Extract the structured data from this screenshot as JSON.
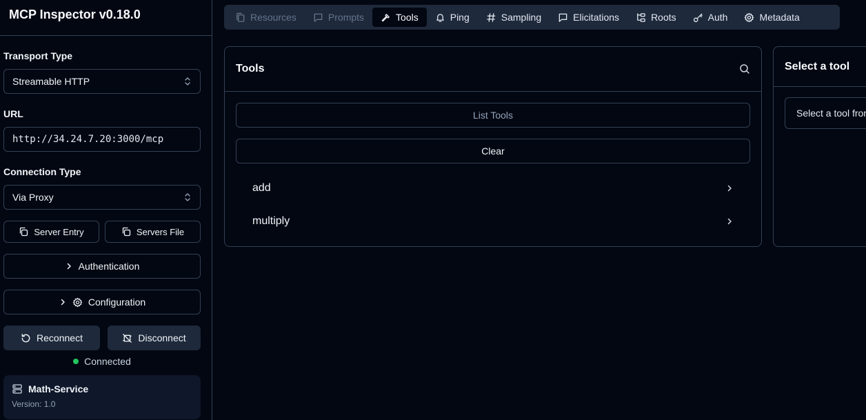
{
  "app": {
    "title": "MCP Inspector v0.18.0"
  },
  "sidebar": {
    "transport_label": "Transport Type",
    "transport_value": "Streamable HTTP",
    "url_label": "URL",
    "url_value": "http://34.24.7.20:3000/mcp",
    "connection_label": "Connection Type",
    "connection_value": "Via Proxy",
    "server_entry_label": "Server Entry",
    "servers_file_label": "Servers File",
    "authentication_label": "Authentication",
    "configuration_label": "Configuration",
    "reconnect_label": "Reconnect",
    "disconnect_label": "Disconnect",
    "status_text": "Connected",
    "server_name": "Math-Service",
    "server_version": "Version: 1.0"
  },
  "tabs": [
    {
      "label": "Resources",
      "icon": "files-icon",
      "state": "disabled"
    },
    {
      "label": "Prompts",
      "icon": "message-icon",
      "state": "disabled"
    },
    {
      "label": "Tools",
      "icon": "hammer-icon",
      "state": "active"
    },
    {
      "label": "Ping",
      "icon": "bell-icon",
      "state": "normal"
    },
    {
      "label": "Sampling",
      "icon": "hash-icon",
      "state": "normal"
    },
    {
      "label": "Elicitations",
      "icon": "message-icon",
      "state": "normal"
    },
    {
      "label": "Roots",
      "icon": "folder-tree-icon",
      "state": "normal"
    },
    {
      "label": "Auth",
      "icon": "key-icon",
      "state": "normal"
    },
    {
      "label": "Metadata",
      "icon": "gear-icon",
      "state": "normal"
    }
  ],
  "tools_panel": {
    "title": "Tools",
    "list_tools_label": "List Tools",
    "clear_label": "Clear",
    "items": [
      "add",
      "multiply"
    ]
  },
  "detail_panel": {
    "title": "Select a tool",
    "hint": "Select a tool from the list to view its details and run it"
  },
  "colors": {
    "background": "#030712",
    "border": "#334155",
    "tabbar": "#1e293b",
    "status_connected": "#22c55e"
  }
}
